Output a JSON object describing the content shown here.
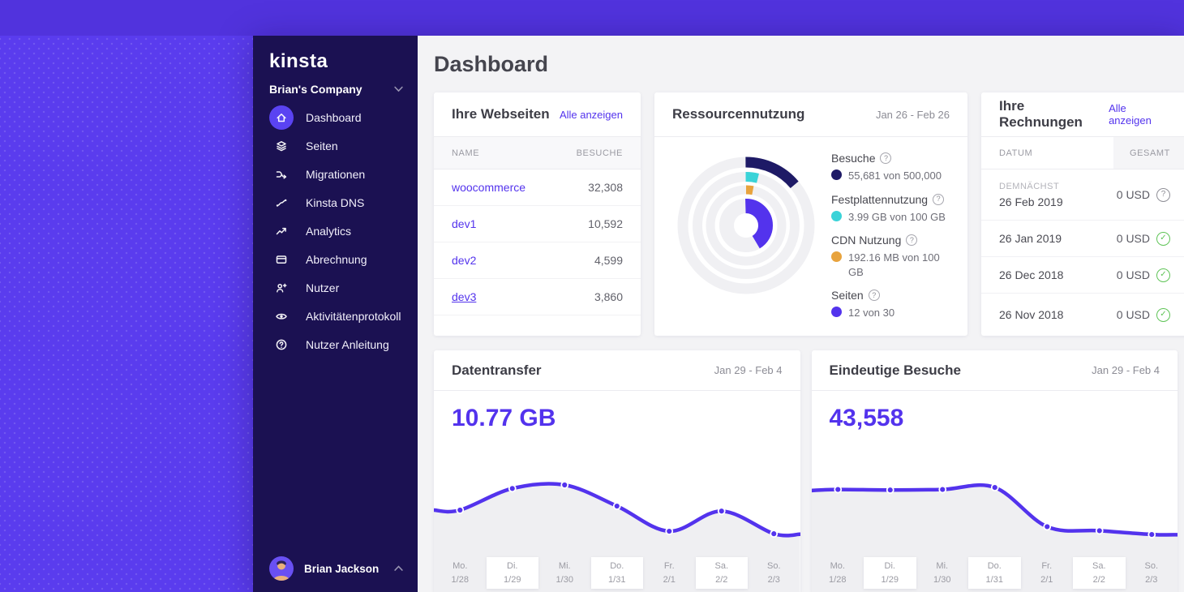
{
  "brand": {
    "logo_text": "Kinsta",
    "accent_color": "#5333ed"
  },
  "page": {
    "title": "Dashboard"
  },
  "sidebar": {
    "company": {
      "name": "Brian's Company"
    },
    "items": [
      {
        "label": "Dashboard",
        "icon": "home",
        "active": true
      },
      {
        "label": "Seiten",
        "icon": "layers",
        "active": false
      },
      {
        "label": "Migrationen",
        "icon": "migrations",
        "active": false
      },
      {
        "label": "Kinsta DNS",
        "icon": "dns",
        "active": false
      },
      {
        "label": "Analytics",
        "icon": "analytics",
        "active": false
      },
      {
        "label": "Abrechnung",
        "icon": "billing",
        "active": false
      },
      {
        "label": "Nutzer",
        "icon": "user-plus",
        "active": false
      },
      {
        "label": "Aktivitätenprotokoll",
        "icon": "eye",
        "active": false
      },
      {
        "label": "Nutzer Anleitung",
        "icon": "help",
        "active": false
      }
    ],
    "user": {
      "name": "Brian Jackson"
    }
  },
  "websites_card": {
    "title": "Ihre Webseiten",
    "link": "Alle anzeigen",
    "columns": [
      "NAME",
      "BESUCHE"
    ],
    "rows": [
      {
        "name": "woocommerce",
        "visits": "32,308",
        "underlined": false
      },
      {
        "name": "dev1",
        "visits": "10,592",
        "underlined": false
      },
      {
        "name": "dev2",
        "visits": "4,599",
        "underlined": false
      },
      {
        "name": "dev3",
        "visits": "3,860",
        "underlined": true
      }
    ]
  },
  "resources_card": {
    "title": "Ressourcennutzung",
    "range": "Jan 26 - Feb 26",
    "legend": [
      {
        "label": "Besuche",
        "value": "55,681 von 500,000",
        "color": "#1e1a66"
      },
      {
        "label": "Festplattennutzung",
        "value": "3.99 GB von 100 GB",
        "color": "#3ad3d8"
      },
      {
        "label": "CDN Nutzung",
        "value": "192.16 MB von 100 GB",
        "color": "#e8a33d"
      },
      {
        "label": "Seiten",
        "value": "12 von 30",
        "color": "#5333ed"
      }
    ]
  },
  "invoices_card": {
    "title": "Ihre Rechnungen",
    "link": "Alle anzeigen",
    "columns": [
      "DATUM",
      "GESAMT"
    ],
    "rows": [
      {
        "tag": "DEMNÄCHST",
        "date": "26 Feb 2019",
        "amount": "0 USD",
        "status": "pending"
      },
      {
        "tag": "",
        "date": "26 Jan 2019",
        "amount": "0 USD",
        "status": "paid"
      },
      {
        "tag": "",
        "date": "26 Dec 2018",
        "amount": "0 USD",
        "status": "paid"
      },
      {
        "tag": "",
        "date": "26 Nov 2018",
        "amount": "0 USD",
        "status": "paid"
      }
    ]
  },
  "transfer_card": {
    "title": "Datentransfer",
    "range": "Jan 29 - Feb 4",
    "total": "10.77 GB"
  },
  "visits_card": {
    "title": "Eindeutige Besuche",
    "range": "Jan 29 - Feb 4",
    "total": "43,558"
  },
  "chart_data": [
    {
      "id": "transfer",
      "type": "line",
      "title": "Datentransfer",
      "period": "Jan 29 - Feb 4",
      "total_label": "10.77 GB",
      "color": "#5333ed",
      "normalized": true,
      "x": [
        {
          "day": "Mo.",
          "date": "1/28"
        },
        {
          "day": "Di.",
          "date": "1/29"
        },
        {
          "day": "Mi.",
          "date": "1/30"
        },
        {
          "day": "Do.",
          "date": "1/31"
        },
        {
          "day": "Fr.",
          "date": "2/1"
        },
        {
          "day": "Sa.",
          "date": "2/2"
        },
        {
          "day": "So.",
          "date": "2/3"
        }
      ],
      "values": [
        0.5,
        0.93,
        1.0,
        0.58,
        0.08,
        0.48,
        0.03
      ],
      "edge_start": 0.5,
      "edge_end": 0.02
    },
    {
      "id": "unique-visits",
      "type": "line",
      "title": "Eindeutige Besuche",
      "period": "Jan 29 - Feb 4",
      "total_label": "43,558",
      "color": "#5333ed",
      "normalized": true,
      "x": [
        {
          "day": "Mo.",
          "date": "1/28"
        },
        {
          "day": "Di.",
          "date": "1/29"
        },
        {
          "day": "Mi.",
          "date": "1/30"
        },
        {
          "day": "Do.",
          "date": "1/31"
        },
        {
          "day": "Fr.",
          "date": "2/1"
        },
        {
          "day": "Sa.",
          "date": "2/2"
        },
        {
          "day": "So.",
          "date": "2/3"
        }
      ],
      "values": [
        0.91,
        0.9,
        0.91,
        0.95,
        0.17,
        0.09,
        0.015
      ],
      "edge_start": 0.89,
      "edge_end": 0.01
    },
    {
      "id": "resources",
      "type": "pie",
      "variant": "concentric-progress-rings",
      "title": "Ressourcennutzung",
      "period": "Jan 26 - Feb 26",
      "rings": [
        {
          "label": "Besuche",
          "used": "55,681",
          "max": "500,000",
          "color": "#1e1a66",
          "sweep_deg": 50
        },
        {
          "label": "Festplattennutzung",
          "used": "3.99 GB",
          "max": "100 GB",
          "color": "#3ad3d8",
          "sweep_deg": 14
        },
        {
          "label": "CDN Nutzung",
          "used": "192.16 MB",
          "max": "100 GB",
          "color": "#e8a33d",
          "sweep_deg": 11
        },
        {
          "label": "Seiten",
          "used": "12",
          "max": "30",
          "color": "#5333ed",
          "sweep_deg": 150
        }
      ]
    }
  ]
}
